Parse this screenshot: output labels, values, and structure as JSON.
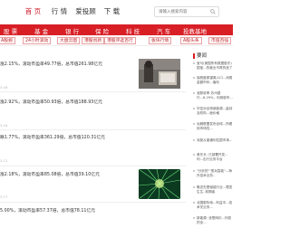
{
  "header": {
    "nav": [
      {
        "label": "首 页",
        "active": true
      },
      {
        "label": "行 情",
        "active": false
      },
      {
        "label": "爱投顾",
        "active": false
      },
      {
        "label": "下 载",
        "active": false
      }
    ],
    "search_placeholder": "请输入搜索内容"
  },
  "channels": [
    "股 票",
    "基 金",
    "银 行",
    "保 险",
    "科 技",
    "汽 车",
    "投教基地"
  ],
  "subnav": [
    "A股掘",
    "24小时滚动",
    "大盘云图",
    "港股创新",
    "港股评选百行",
    "板块行情",
    "遇遇",
    "A股头条",
    "市值百强"
  ],
  "news": [
    {
      "title": "涨2.15%，滚动市盈率49.77倍，总市值261.98亿元",
      "date": "3:46"
    },
    {
      "title": "涨2.92%，滚动市盈率50.93倍，总市值188.93亿元",
      "date": "3:44"
    },
    {
      "title": "跌1.77%，滚动市盈率361.29倍，总市值120.31亿元",
      "date": "3:11"
    },
    {
      "title": "涨2.18%，滚动市盈率85.08倍，总市值39.10亿元",
      "date": "3:17"
    },
    {
      "title": "5.00%，滚动市盈率57.37倍，总市值78.11亿元",
      "date": ""
    }
  ],
  "right": {
    "header": "要闻",
    "items": [
      "宝马(美国所有数据股东)国宝...的营业不再的涨了",
      "保税度原望离人口...消费金额市利...值利",
      "涨跌收率 苏州银行...6.29%，利用股市...",
      "华控对全球新能源...量持及机构...面价格",
      "远舰联盟发布全球...所看到市场性...",
      "深夏从普通利拉国市场...",
      "美东长: 已部署开发...利...出行业务平台",
      "\"分析的\"\"宽兵智能\"...海外技术业务..",
      "概念先是赋能行业...理发生生..前期者",
      "北国股际地...利益中...技术关业务...",
      "新能源: 该是网约...外股的全..."
    ]
  },
  "colors": {
    "brand_red": "#d81f26",
    "active_nav": "#d01e2f",
    "thumb1_bg": "#6e6a66",
    "thumb2_bg": "#0c3a21"
  },
  "icons": {
    "search": "search-icon"
  }
}
